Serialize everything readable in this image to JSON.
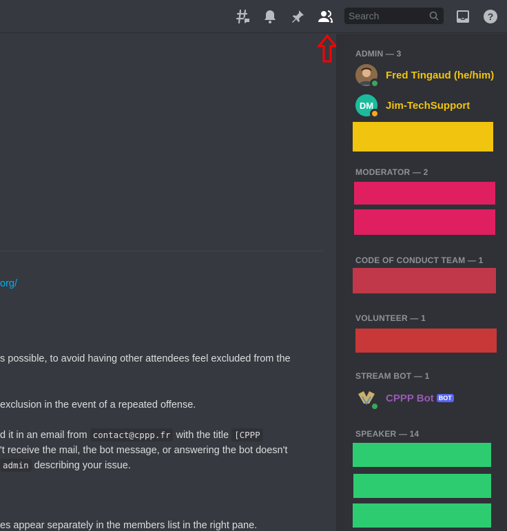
{
  "topbar": {
    "icons": [
      "threads-icon",
      "notification-bell-icon",
      "pin-icon",
      "member-list-icon",
      "inbox-icon",
      "help-icon"
    ],
    "search_placeholder": "Search"
  },
  "chat": {
    "lines": [
      {
        "text": "org/",
        "kind": "link"
      },
      {
        "text": "s possible, to avoid having other attendees feel excluded from the"
      },
      {
        "text": "exclusion in the event of a repeated offense."
      },
      {
        "pre": "d it in an email from ",
        "code1": "contact@cppp.fr",
        "mid": " with the title ",
        "code2": "[CPPP"
      },
      {
        "text": "'t receive the mail, the bot message, or answering the bot doesn't"
      },
      {
        "code": "admin",
        "post": " describing your issue."
      },
      {
        "text": "es appear separately in the members list in the right pane."
      }
    ]
  },
  "members": {
    "groups": [
      {
        "title": "ADMIN — 3"
      },
      {
        "title": "MODERATOR — 2"
      },
      {
        "title": "CODE OF CONDUCT TEAM — 1"
      },
      {
        "title": "VOLUNTEER — 1"
      },
      {
        "title": "STREAM BOT — 1"
      },
      {
        "title": "SPEAKER — 14"
      }
    ],
    "admin": [
      {
        "name": "Fred Tingaud (he/him)",
        "color": "#f1c40f",
        "status": "online"
      },
      {
        "name": "Jim-TechSupport",
        "color": "#f1c40f",
        "status": "idle",
        "avatar_text": "DM"
      }
    ],
    "stream_bot": {
      "name": "CPPP Bot",
      "badge": "BOT",
      "color": "#9b59b6",
      "status": "online"
    }
  },
  "colors": {
    "admin_redaction": "#f1c40f",
    "moderator_redaction": "#e91e63",
    "coc_redaction": "#c0384a",
    "volunteer_redaction": "#c83838",
    "speaker_redaction": "#2ecc71",
    "online": "#3ba55c",
    "idle": "#faa61a",
    "arrow": "#ff0000"
  }
}
